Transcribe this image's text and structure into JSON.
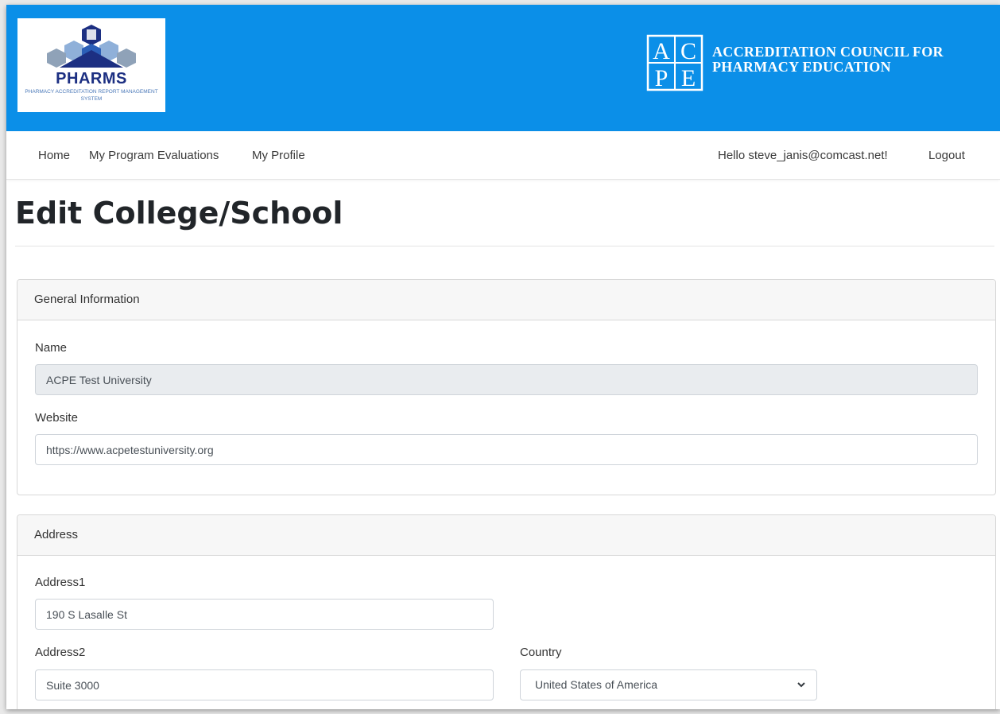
{
  "branding": {
    "logo_name": "PHARMS",
    "logo_subtitle": "PHARMACY ACCREDITATION REPORT MANAGEMENT SYSTEM",
    "org_name_line1": "ACCREDITATION COUNCIL FOR",
    "org_name_line2": "PHARMACY EDUCATION",
    "banner_color": "#0b8fe8"
  },
  "nav": {
    "home": "Home",
    "evaluations": "My Program Evaluations",
    "profile": "My Profile",
    "greeting": "Hello steve_janis@comcast.net!",
    "logout": "Logout"
  },
  "page": {
    "title": "Edit College/School"
  },
  "general_info": {
    "header": "General Information",
    "name_label": "Name",
    "name_value": "ACPE Test University",
    "website_label": "Website",
    "website_value": "https://www.acpetestuniversity.org"
  },
  "address": {
    "header": "Address",
    "address1_label": "Address1",
    "address1_value": "190 S Lasalle St",
    "address2_label": "Address2",
    "address2_value": "Suite 3000",
    "country_label": "Country",
    "country_value": "United States of America"
  },
  "icons": {
    "select_arrow": "chevron-down-icon"
  }
}
